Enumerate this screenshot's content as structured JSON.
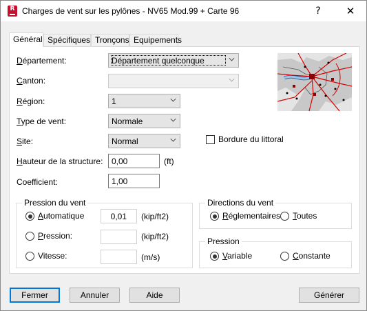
{
  "window": {
    "title": "Charges de vent sur les pylônes - NV65 Mod.99 + Carte 96",
    "app_icon_letter": "R",
    "help_glyph": "?",
    "close_glyph": "✕"
  },
  "tabs": [
    {
      "label": "Général",
      "active": true
    },
    {
      "label": "Spécifiques",
      "active": false
    },
    {
      "label": "Tronçons",
      "active": false
    },
    {
      "label": "Equipements",
      "active": false
    }
  ],
  "form": {
    "departement_label": "Département:",
    "departement_value": "Département quelconque",
    "canton_label": "Canton:",
    "canton_value": "",
    "region_label": "Région:",
    "region_value": "1",
    "type_vent_label": "Type de vent:",
    "type_vent_value": "Normale",
    "site_label": "Site:",
    "site_value": "Normal",
    "bordure_label": "Bordure du littoral",
    "bordure_checked": false,
    "hauteur_label": "Hauteur de la structure:",
    "hauteur_value": "0,00",
    "hauteur_unit": "(ft)",
    "coefficient_label": "Coefficient:",
    "coefficient_value": "1,00"
  },
  "pression_vent": {
    "title": "Pression du vent",
    "automatique_label": "Automatique",
    "automatique_value": "0,01",
    "automatique_unit": "(kip/ft2)",
    "pression_label": "Pression:",
    "pression_value": "",
    "pression_unit": "(kip/ft2)",
    "vitesse_label": "Vitesse:",
    "vitesse_value": "",
    "vitesse_unit": "(m/s)",
    "selected": "automatique"
  },
  "directions": {
    "title": "Directions du vent",
    "reglementaires_label": "Réglementaires",
    "toutes_label": "Toutes",
    "selected": "reglementaires"
  },
  "pression": {
    "title": "Pression",
    "variable_label": "Variable",
    "constante_label": "Constante",
    "selected": "variable"
  },
  "buttons": {
    "fermer": "Fermer",
    "annuler": "Annuler",
    "aide": "Aide",
    "generer": "Générer"
  },
  "colors": {
    "accent": "#0078d7",
    "app_icon": "#c8102e",
    "map_road": "#d40000",
    "map_marker": "#8b0000"
  }
}
